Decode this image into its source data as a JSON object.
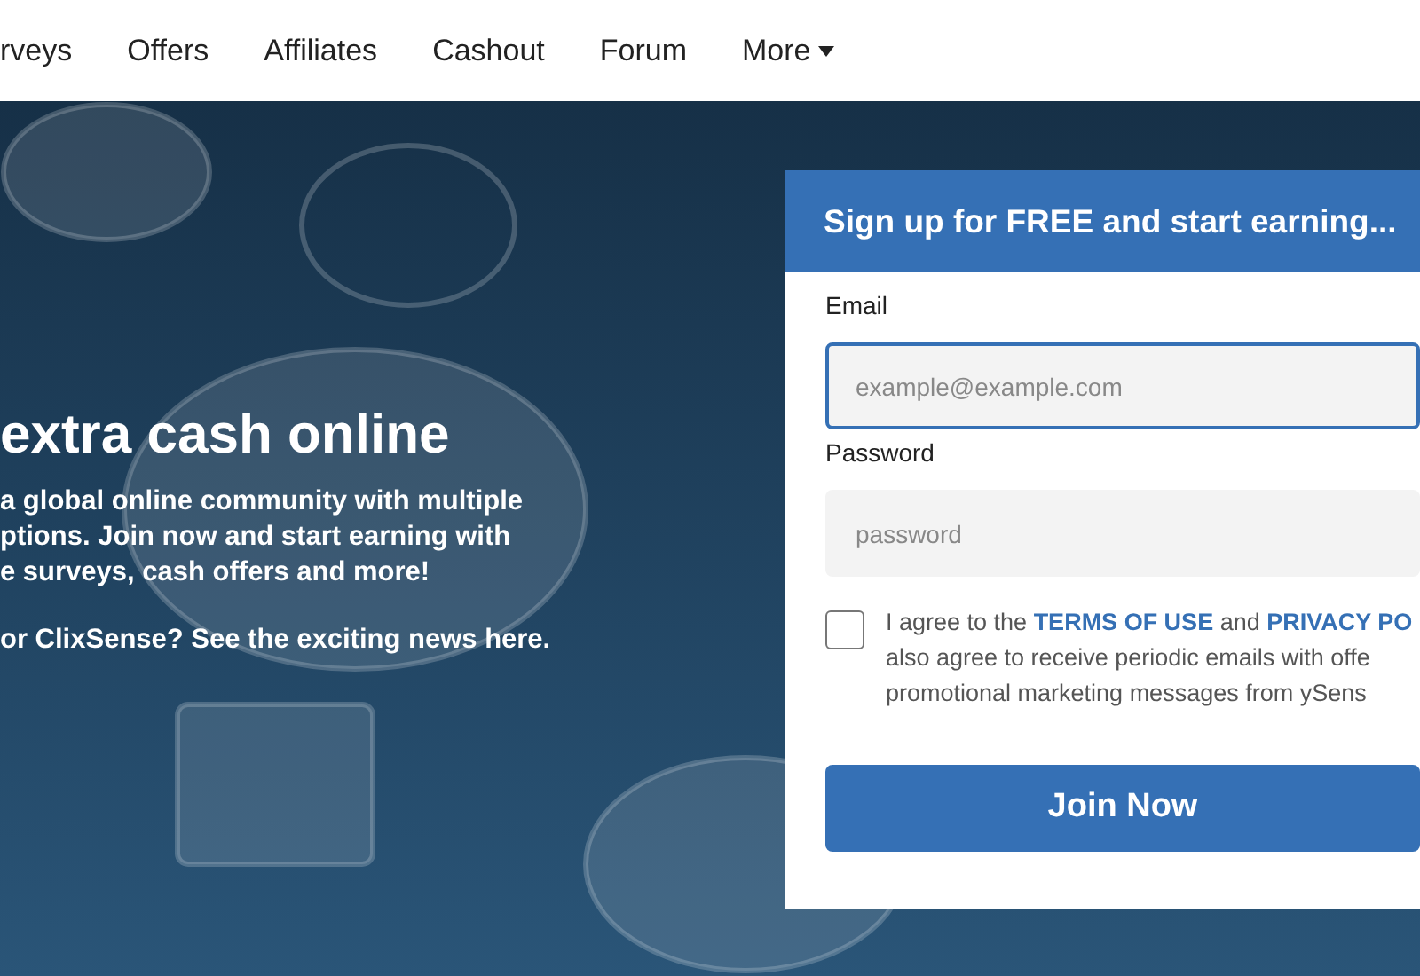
{
  "nav": [
    {
      "label": "rveys"
    },
    {
      "label": "Offers"
    },
    {
      "label": "Affiliates"
    },
    {
      "label": "Cashout"
    },
    {
      "label": "Forum"
    },
    {
      "label": "More",
      "dropdown": true
    }
  ],
  "hero": {
    "heading": "extra cash online",
    "lines": [
      "a global online community with multiple",
      "ptions. Join now and start earning with",
      "e surveys, cash offers and more!"
    ],
    "news": "or ClixSense? See the exciting news here."
  },
  "signup": {
    "title": "Sign up for FREE and start earning...",
    "fields": [
      {
        "label": "Email",
        "placeholder": "example@example.com",
        "focused": true
      },
      {
        "label": "Password",
        "placeholder": "password",
        "focused": false
      }
    ],
    "agree": {
      "checked": false,
      "parts": [
        {
          "kind": "text",
          "text": "I agree to the "
        },
        {
          "kind": "link",
          "text": "TERMS OF USE"
        },
        {
          "kind": "text",
          "text": " and "
        },
        {
          "kind": "link",
          "text": "PRIVACY PO"
        },
        {
          "kind": "break"
        },
        {
          "kind": "text",
          "text": "also agree to receive periodic emails with offe"
        },
        {
          "kind": "break"
        },
        {
          "kind": "text",
          "text": "promotional marketing messages from ySens"
        }
      ]
    },
    "button": "Join Now"
  }
}
